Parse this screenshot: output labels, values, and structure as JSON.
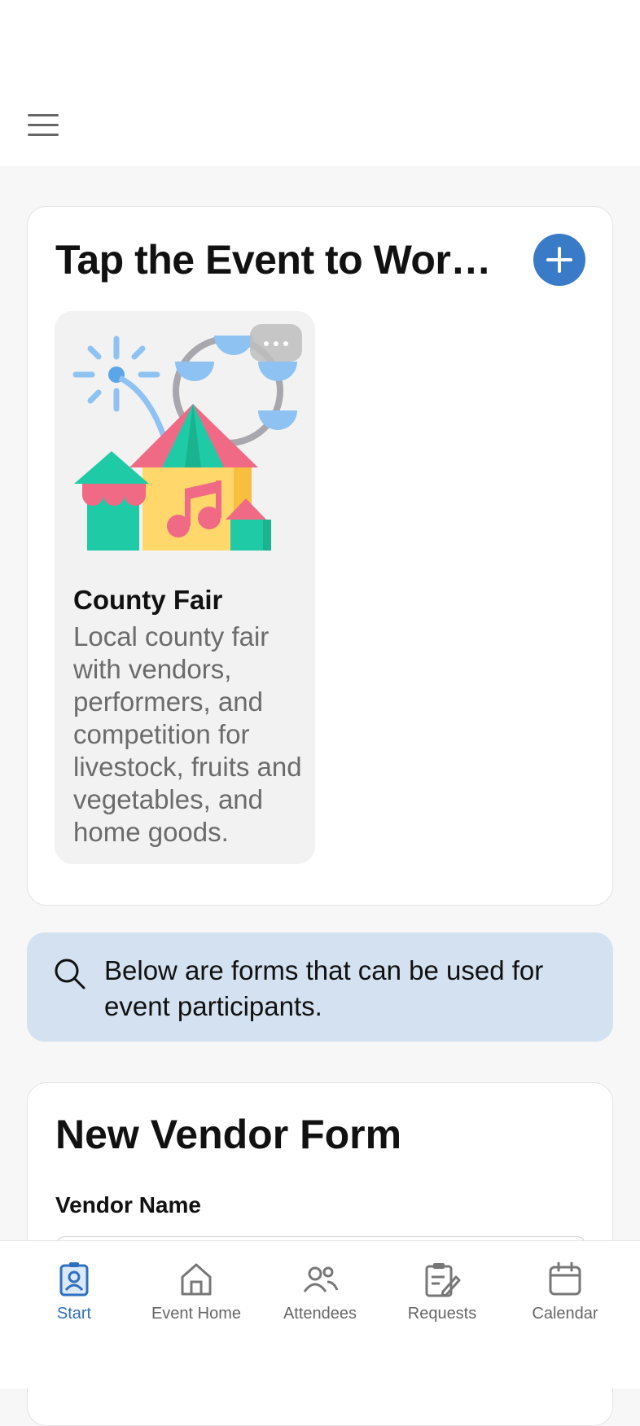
{
  "header": {
    "menu_icon": "hamburger-menu-icon"
  },
  "events": {
    "title": "Tap the Event to Work ...",
    "add_icon": "plus-icon",
    "items": [
      {
        "name": "County Fair",
        "description": "Local county fair with vendors, performers, and competition for livestock, fruits and vegetables, and home goods.",
        "image_icon": "county-fair-illustration",
        "more_icon": "ellipsis-icon"
      }
    ]
  },
  "info_banner": {
    "icon": "search-icon",
    "text": "Below are forms that can be used for event participants."
  },
  "vendor_form": {
    "title": "New Vendor Form",
    "fields": [
      {
        "label": "Vendor Name",
        "value": ""
      }
    ]
  },
  "tabbar": {
    "tabs": [
      {
        "label": "Start",
        "icon": "badge-icon",
        "active": true
      },
      {
        "label": "Event Home",
        "icon": "home-icon",
        "active": false
      },
      {
        "label": "Attendees",
        "icon": "people-icon",
        "active": false
      },
      {
        "label": "Requests",
        "icon": "clipboard-edit-icon",
        "active": false
      },
      {
        "label": "Calendar",
        "icon": "calendar-icon",
        "active": false
      }
    ]
  },
  "colors": {
    "accent": "#3a7bc8",
    "active_tab": "#2f6fbf",
    "banner": "#d4e1f0"
  }
}
